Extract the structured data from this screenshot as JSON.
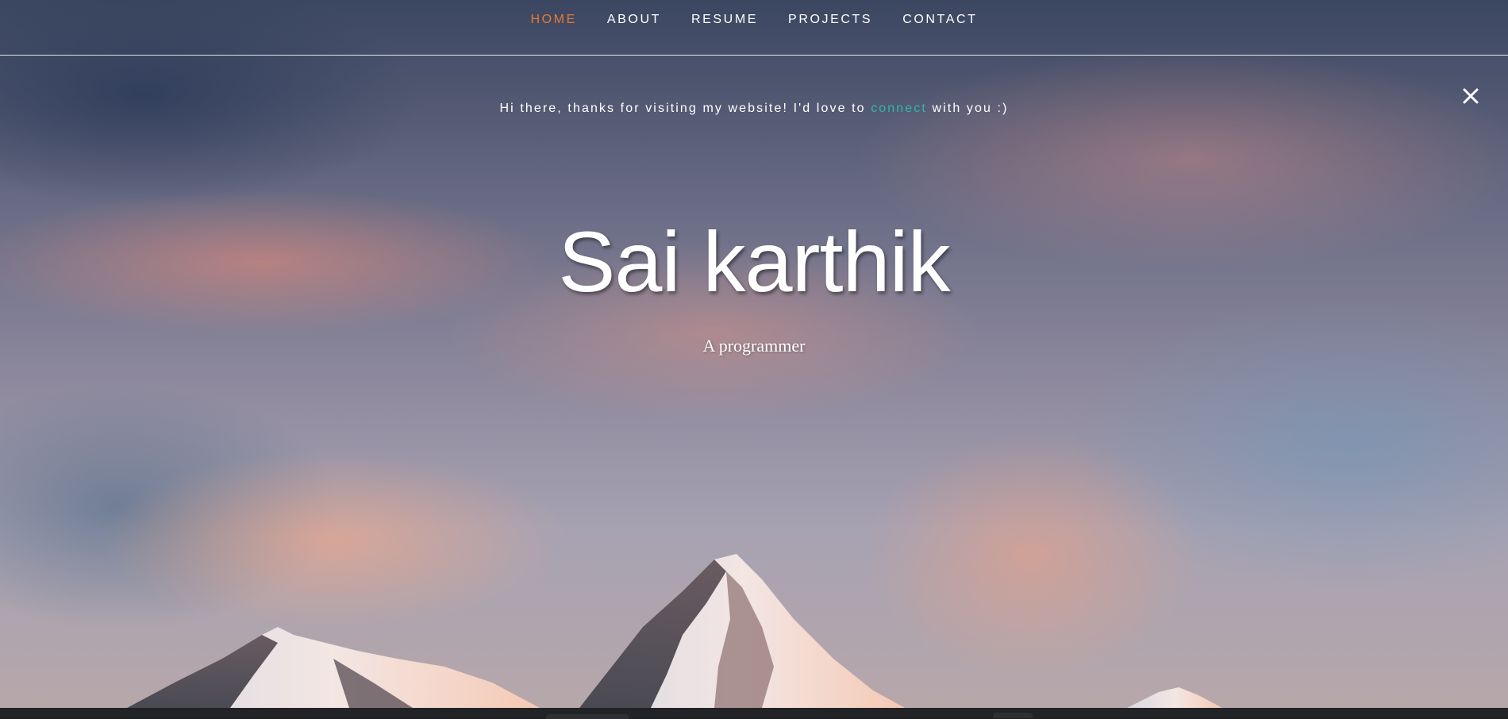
{
  "nav": {
    "items": [
      {
        "label": "HOME"
      },
      {
        "label": "ABOUT"
      },
      {
        "label": "RESUME"
      },
      {
        "label": "PROJECTS"
      },
      {
        "label": "CONTACT"
      }
    ],
    "active_index": 0
  },
  "banner": {
    "text_before": "Hi there, thanks for visiting my website! I'd love to ",
    "link_text": "connect",
    "text_after": " with you :)",
    "close_icon": "close-icon"
  },
  "hero": {
    "name": "Sai karthik",
    "tagline": "A programmer",
    "background": "mountain-sunset-image"
  },
  "colors": {
    "nav_active": "#e07c32",
    "nav_text": "#ffffff",
    "link": "#31b6a9",
    "page_bottom": "#222326"
  }
}
